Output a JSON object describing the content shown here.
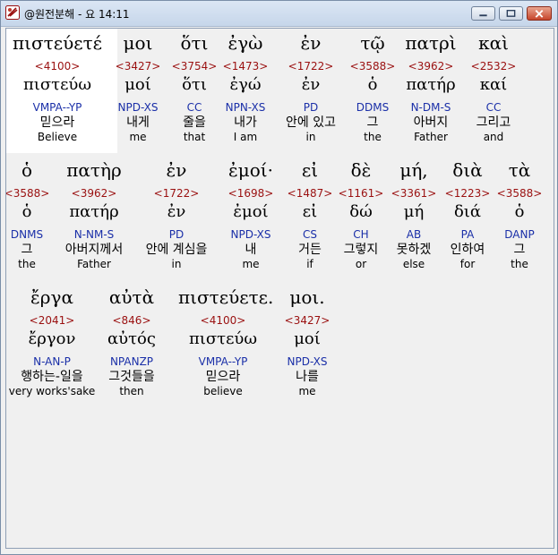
{
  "window": {
    "title": "@원전분해 - 요 14:11"
  },
  "rows": [
    [
      {
        "greek": "πιστεύετέ",
        "strong": "<4100>",
        "lemma": "πιστεύω",
        "parse": "VMPA--YP",
        "korean": "믿으라",
        "english": "Believe"
      },
      {
        "greek": "μοι",
        "strong": "<3427>",
        "lemma": "μοί",
        "parse": "NPD-XS",
        "korean": "내게",
        "english": "me"
      },
      {
        "greek": "ὅτι",
        "strong": "<3754>",
        "lemma": "ὅτι",
        "parse": "CC",
        "korean": "줄을",
        "english": "that"
      },
      {
        "greek": "ἐγὼ",
        "strong": "<1473>",
        "lemma": "ἐγώ",
        "parse": "NPN-XS",
        "korean": "내가",
        "english": "I am"
      },
      {
        "greek": "ἐν",
        "strong": "<1722>",
        "lemma": "ἐν",
        "parse": "PD",
        "korean": "안에 있고",
        "english": "in"
      },
      {
        "greek": "τῷ",
        "strong": "<3588>",
        "lemma": "ὁ",
        "parse": "DDMS",
        "korean": "그",
        "english": "the"
      },
      {
        "greek": "πατρὶ",
        "strong": "<3962>",
        "lemma": "πατήρ",
        "parse": "N-DM-S",
        "korean": "아버지",
        "english": "Father"
      },
      {
        "greek": "καὶ",
        "strong": "<2532>",
        "lemma": "καί",
        "parse": "CC",
        "korean": "그리고",
        "english": "and"
      }
    ],
    [
      {
        "greek": "ὁ",
        "strong": "<3588>",
        "lemma": "ὁ",
        "parse": "DNMS",
        "korean": "그",
        "english": "the"
      },
      {
        "greek": "πατὴρ",
        "strong": "<3962>",
        "lemma": "πατήρ",
        "parse": "N-NM-S",
        "korean": "아버지께서",
        "english": "Father"
      },
      {
        "greek": "ἐν",
        "strong": "<1722>",
        "lemma": "ἐν",
        "parse": "PD",
        "korean": "안에 계심을",
        "english": "in"
      },
      {
        "greek": "ἐμοί·",
        "strong": "<1698>",
        "lemma": "ἐμοί",
        "parse": "NPD-XS",
        "korean": "내",
        "english": "me"
      },
      {
        "greek": "εἰ",
        "strong": "<1487>",
        "lemma": "εἰ",
        "parse": "CS",
        "korean": "거든",
        "english": "if"
      },
      {
        "greek": "δὲ",
        "strong": "<1161>",
        "lemma": "δώ",
        "parse": "CH",
        "korean": "그렇지",
        "english": "or"
      },
      {
        "greek": "μή,",
        "strong": "<3361>",
        "lemma": "μή",
        "parse": "AB",
        "korean": "못하겠",
        "english": "else"
      },
      {
        "greek": "διὰ",
        "strong": "<1223>",
        "lemma": "διά",
        "parse": "PA",
        "korean": "인하여",
        "english": "for"
      },
      {
        "greek": "τὰ",
        "strong": "<3588>",
        "lemma": "ὁ",
        "parse": "DANP",
        "korean": "그",
        "english": "the"
      }
    ],
    [
      {
        "greek": "ἔργα",
        "strong": "<2041>",
        "lemma": "ἔργον",
        "parse": "N-AN-P",
        "korean": "행하는-일을",
        "english": "very works'sake"
      },
      {
        "greek": "αὐτὰ",
        "strong": "<846>",
        "lemma": "αὐτός",
        "parse": "NPANZP",
        "korean": "그것들을",
        "english": "then"
      },
      {
        "greek": "πιστεύετε.",
        "strong": "<4100>",
        "lemma": "πιστεύω",
        "parse": "VMPA--YP",
        "korean": "믿으라",
        "english": "believe"
      },
      {
        "greek": "μοι.",
        "strong": "<3427>",
        "lemma": "μοί",
        "parse": "NPD-XS",
        "korean": "나를",
        "english": "me"
      }
    ]
  ]
}
